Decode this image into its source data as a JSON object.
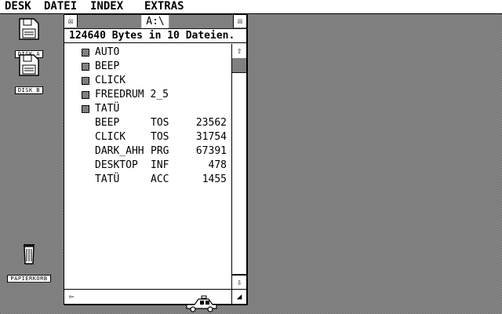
{
  "menubar": {
    "items": [
      "DESK",
      "DATEI",
      "INDEX",
      "EXTRAS"
    ]
  },
  "desktop": {
    "drive_a_label": "DISK A",
    "drive_b_label": "DISK B",
    "trash_label": "PAPIERKORB"
  },
  "window": {
    "title": "A:\\",
    "info": "124640 Bytes in 10 Dateien.",
    "folders": [
      {
        "name": "AUTO"
      },
      {
        "name": "BEEP"
      },
      {
        "name": "CLICK"
      },
      {
        "name": "FREEDRUM 2_5"
      },
      {
        "name": "TATÜ"
      }
    ],
    "files": [
      {
        "name": "BEEP",
        "ext": "TOS",
        "size": "23562"
      },
      {
        "name": "CLICK",
        "ext": "TOS",
        "size": "31754"
      },
      {
        "name": "DARK_AHH",
        "ext": "PRG",
        "size": "67391"
      },
      {
        "name": "DESKTOP",
        "ext": "INF",
        "size": "478"
      },
      {
        "name": "TATÜ",
        "ext": "ACC",
        "size": "1455"
      }
    ]
  },
  "icons": {
    "close": "close-box-icon",
    "fuller": "fuller-box-icon",
    "up": "arrow-up-icon",
    "down": "arrow-down-icon",
    "left": "arrow-left-icon",
    "sizer": "size-box-icon"
  }
}
